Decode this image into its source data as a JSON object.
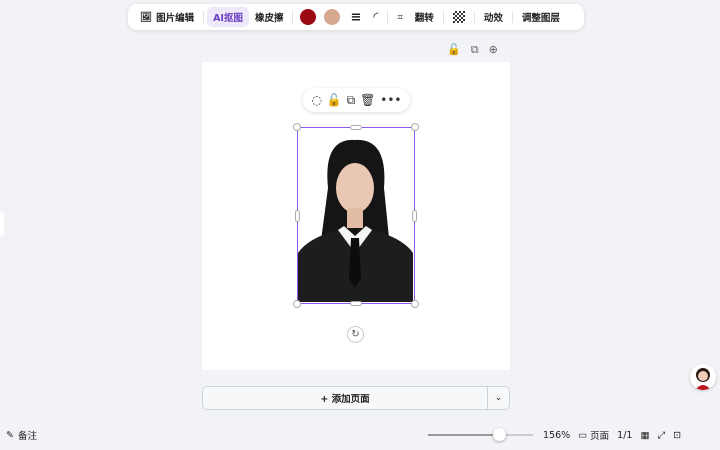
{
  "toolbar": {
    "image_edit": "图片编辑",
    "ai_cutout": "AI抠图",
    "eraser": "橡皮擦",
    "color1": "#9b0a12",
    "color2": "#d4a98e",
    "flip": "翻转",
    "animation": "动效",
    "adjust_layer": "调整图层"
  },
  "add_page": {
    "label": "+ 添加页面"
  },
  "bottom": {
    "notes": "备注",
    "zoom": "156%",
    "zoom_fraction": 0.68,
    "pages_label": "页面",
    "page_count": "1/1"
  }
}
